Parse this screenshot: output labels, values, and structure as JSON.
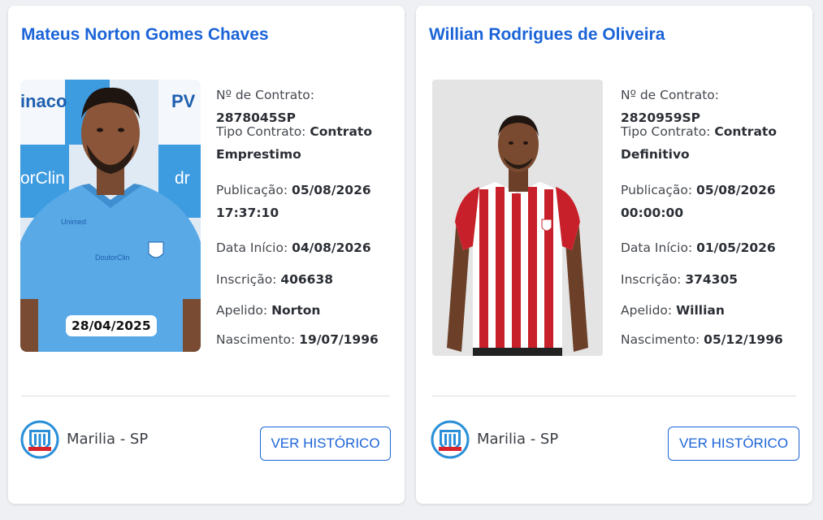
{
  "cards": [
    {
      "name": "Mateus Norton Gomes Chaves",
      "photo_date": "28/04/2025",
      "fields": [
        {
          "label": "Nº de Contrato: ",
          "value": "2878045SP"
        },
        {
          "label": "Tipo Contrato: ",
          "value": "Contrato Emprestimo"
        },
        {
          "label": "Publicação: ",
          "value": "05/08/2026 17:37:10"
        },
        {
          "label": "Data Início: ",
          "value": "04/08/2026"
        },
        {
          "label": "Inscrição: ",
          "value": "406638"
        },
        {
          "label": "Apelido: ",
          "value": "Norton"
        },
        {
          "label": "Nascimento: ",
          "value": "19/07/1996"
        }
      ],
      "club": "Marilia - SP",
      "button_label": "VER HISTÓRICO"
    },
    {
      "name": "Willian Rodrigues de Oliveira",
      "fields": [
        {
          "label": "Nº de Contrato: ",
          "value": "2820959SP"
        },
        {
          "label": "Tipo Contrato: ",
          "value": "Contrato Definitivo"
        },
        {
          "label": "Publicação: ",
          "value": "05/08/2026 00:00:00"
        },
        {
          "label": "Data Início: ",
          "value": "01/05/2026"
        },
        {
          "label": "Inscrição: ",
          "value": "374305"
        },
        {
          "label": "Apelido: ",
          "value": "Willian"
        },
        {
          "label": "Nascimento: ",
          "value": "05/12/1996"
        }
      ],
      "club": "Marilia - SP",
      "button_label": "VER HISTÓRICO"
    }
  ],
  "photo_backdrop_text": [
    "inaco",
    "PV",
    "orClin",
    "dr"
  ],
  "jersey_text": [
    "Unimed",
    "DoutorClin"
  ],
  "colors": {
    "accent": "#1b64d8",
    "club_blue": "#2a8fd8",
    "club_red": "#d8232a"
  }
}
